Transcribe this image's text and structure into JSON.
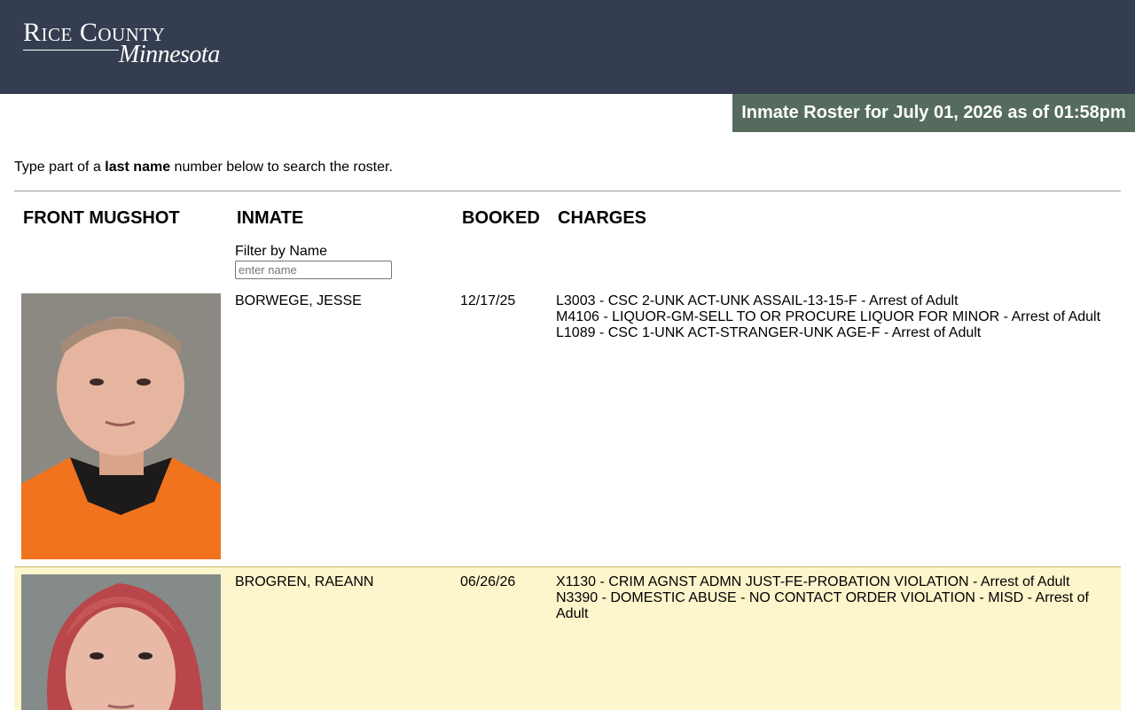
{
  "header": {
    "logo_main": "Rice County",
    "logo_script": "Minnesota"
  },
  "banner": {
    "text": "Inmate Roster for July 01, 2026 as of 01:58pm"
  },
  "instructions": {
    "prefix": "Type part of a ",
    "bold": "last name",
    "suffix": " number below to search the roster."
  },
  "columns": {
    "mugshot": "FRONT MUGSHOT",
    "inmate": "INMATE",
    "booked": "BOOKED",
    "charges": "CHARGES"
  },
  "filter": {
    "label": "Filter by Name",
    "placeholder": "enter name",
    "value": ""
  },
  "inmates": [
    {
      "name": "BORWEGE, JESSE",
      "booked": "12/17/25",
      "charges": [
        "L3003 - CSC 2-UNK ACT-UNK ASSAIL-13-15-F - Arrest of Adult",
        "M4106 - LIQUOR-GM-SELL TO OR PROCURE LIQUOR FOR MINOR - Arrest of Adult",
        "L1089 - CSC 1-UNK ACT-STRANGER-UNK AGE-F - Arrest of Adult"
      ]
    },
    {
      "name": "BROGREN, RAEANN",
      "booked": "06/26/26",
      "charges": [
        "X1130 - CRIM AGNST ADMN JUST-FE-PROBATION VIOLATION - Arrest of Adult",
        "N3390 - DOMESTIC ABUSE - NO CONTACT ORDER VIOLATION - MISD - Arrest of Adult"
      ]
    }
  ],
  "colors": {
    "header_bg": "#343e50",
    "banner_bg": "#556b5d",
    "alt_row_bg": "#fdf5cc"
  }
}
